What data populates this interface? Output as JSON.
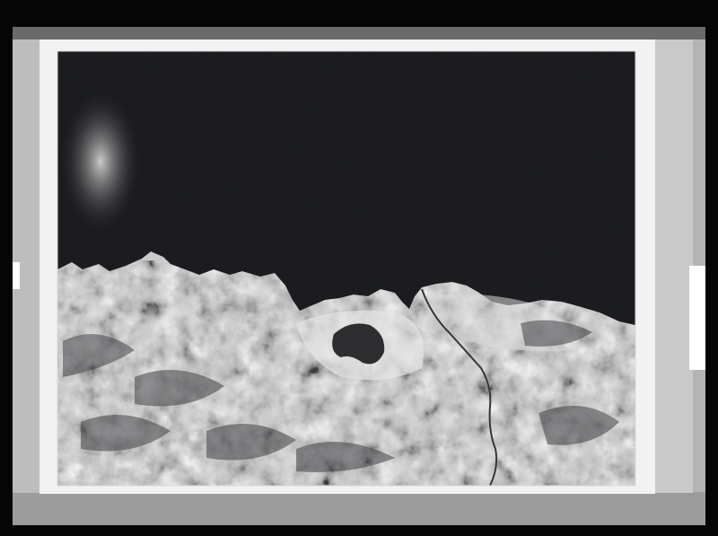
{
  "photo": {
    "subject": "aerial-coastline-negative-scan",
    "colors": {
      "scan_background": "#050505",
      "film_base": "#b8b8b8",
      "paper_border": "#f1f1f1",
      "sea": "#101113",
      "land_light": "#d9d9d9",
      "land_dark": "#3a3a3a"
    }
  }
}
